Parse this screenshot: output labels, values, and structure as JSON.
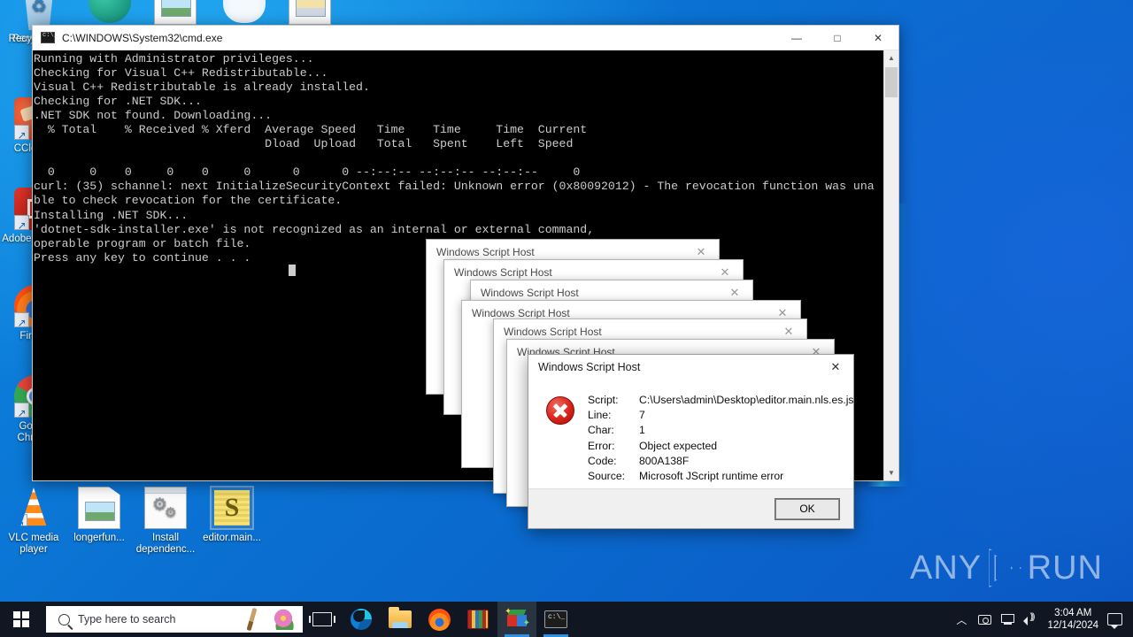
{
  "desktop": {
    "icons": [
      {
        "label": "Recycle Bin",
        "name": "recycle-bin",
        "glyph": "bin"
      },
      {
        "label": "CCleaner",
        "name": "ccleaner",
        "glyph": "cc"
      },
      {
        "label": "Adobe Acrobat",
        "name": "adobe-acrobat",
        "glyph": "pdf"
      },
      {
        "label": "Firefox",
        "name": "firefox",
        "glyph": "ff"
      },
      {
        "label": "Google Chrome",
        "name": "google-chrome",
        "glyph": "chrome"
      },
      {
        "label": "VLC media player",
        "name": "vlc-media-player",
        "glyph": "vlc"
      },
      {
        "label": "longerfun...",
        "name": "longerfun-file",
        "glyph": "doc"
      },
      {
        "label": "Install dependenc...",
        "name": "install-dependencies",
        "glyph": "inst"
      },
      {
        "label": "editor.main...",
        "name": "editor-main-script",
        "glyph": "js"
      }
    ]
  },
  "cmd": {
    "title": "C:\\WINDOWS\\System32\\cmd.exe",
    "minimize_label": "—",
    "maximize_label": "□",
    "close_label": "✕",
    "output": "Running with Administrator privileges...\nChecking for Visual C++ Redistributable...\nVisual C++ Redistributable is already installed.\nChecking for .NET SDK...\n.NET SDK not found. Downloading...\n  % Total    % Received % Xferd  Average Speed   Time    Time     Time  Current\n                                 Dload  Upload   Total   Spent    Left  Speed\n\n  0     0    0     0    0     0      0      0 --:--:-- --:--:-- --:--:--     0\ncurl: (35) schannel: next InitializeSecurityContext failed: Unknown error (0x80092012) - The revocation function was una\nble to check revocation for the certificate.\nInstalling .NET SDK...\n'dotnet-sdk-installer.exe' is not recognized as an internal or external command,\noperable program or batch file.\nPress any key to continue . . . "
  },
  "dialogs": {
    "title": "Windows Script Host",
    "close_label": "✕",
    "background_count": 6,
    "front": {
      "title": "Windows Script Host",
      "rows": [
        {
          "label": "Script:",
          "value": "C:\\Users\\admin\\Desktop\\editor.main.nls.es.js"
        },
        {
          "label": "Line:",
          "value": "7"
        },
        {
          "label": "Char:",
          "value": "1"
        },
        {
          "label": "Error:",
          "value": "Object expected"
        },
        {
          "label": "Code:",
          "value": "800A138F"
        },
        {
          "label": "Source:",
          "value": "Microsoft JScript runtime error"
        }
      ],
      "ok_label": "OK"
    }
  },
  "taskbar": {
    "search_placeholder": "Type here to search",
    "buttons": [
      {
        "name": "task-view-button",
        "glyph": "taskview"
      },
      {
        "name": "microsoft-edge-button",
        "glyph": "edge"
      },
      {
        "name": "file-explorer-button",
        "glyph": "folder"
      },
      {
        "name": "firefox-button",
        "glyph": "firefox"
      },
      {
        "name": "winrar-button",
        "glyph": "winrar"
      },
      {
        "name": "script-app-button",
        "glyph": "cube"
      },
      {
        "name": "command-prompt-button",
        "glyph": "cmd"
      }
    ],
    "clock_time": "3:04 AM",
    "clock_date": "12/14/2024"
  },
  "watermark": {
    "text_left": "ANY",
    "text_right": "RUN"
  }
}
